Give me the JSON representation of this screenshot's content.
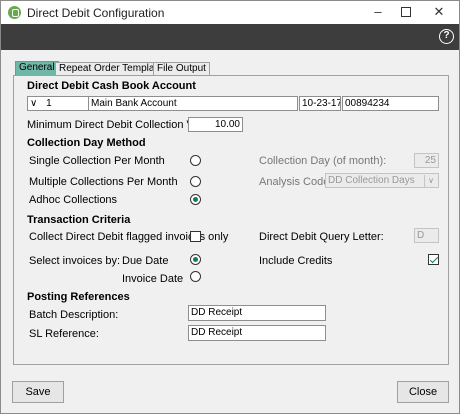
{
  "window": {
    "title": "Direct Debit Configuration",
    "help_glyph": "?",
    "controls": {
      "minimize": "–",
      "maximize": "",
      "close": "✕"
    }
  },
  "tabs": [
    {
      "label": "General",
      "active": true
    },
    {
      "label": "Repeat Order Templates",
      "active": false
    },
    {
      "label": "File Output",
      "active": false
    }
  ],
  "cashbook": {
    "heading": "Direct Debit Cash Book Account",
    "account_number": "1",
    "dropdown_glyph": "∨",
    "account_name": "Main Bank Account",
    "sort_code": "10-23-17",
    "account_code": "00894234"
  },
  "minimum": {
    "label": "Minimum Direct Debit Collection Value:",
    "value": "10.00"
  },
  "collection_method": {
    "heading": "Collection Day Method",
    "options": [
      {
        "label": "Single Collection Per Month",
        "selected": false
      },
      {
        "label": "Multiple Collections Per Month",
        "selected": false
      },
      {
        "label": "Adhoc Collections",
        "selected": true
      }
    ],
    "collection_day_label": "Collection Day (of month):",
    "collection_day_value": "25",
    "analysis_code_label": "Analysis Code:",
    "analysis_code_value": "DD Collection Days",
    "analysis_arrow": "∨"
  },
  "transaction": {
    "heading": "Transaction Criteria",
    "collect_flagged_label": "Collect Direct Debit flagged invoices only",
    "collect_flagged_checked": false,
    "query_letter_label": "Direct Debit Query Letter:",
    "query_letter_value": "D",
    "select_by_label": "Select invoices by:",
    "due_date_label": "Due Date",
    "due_date_selected": true,
    "invoice_date_label": "Invoice Date",
    "invoice_date_selected": false,
    "include_credits_label": "Include Credits",
    "include_credits_checked": true
  },
  "posting": {
    "heading": "Posting References",
    "batch_label": "Batch Description:",
    "batch_value": "DD Receipt",
    "sl_label": "SL Reference:",
    "sl_value": "DD Receipt"
  },
  "footer": {
    "save_label": "Save",
    "close_label": "Close"
  },
  "colors": {
    "active_tab": "#6fb8a8",
    "header_bar": "#3d3d3d",
    "selection_accent": "#1a7a5a"
  }
}
